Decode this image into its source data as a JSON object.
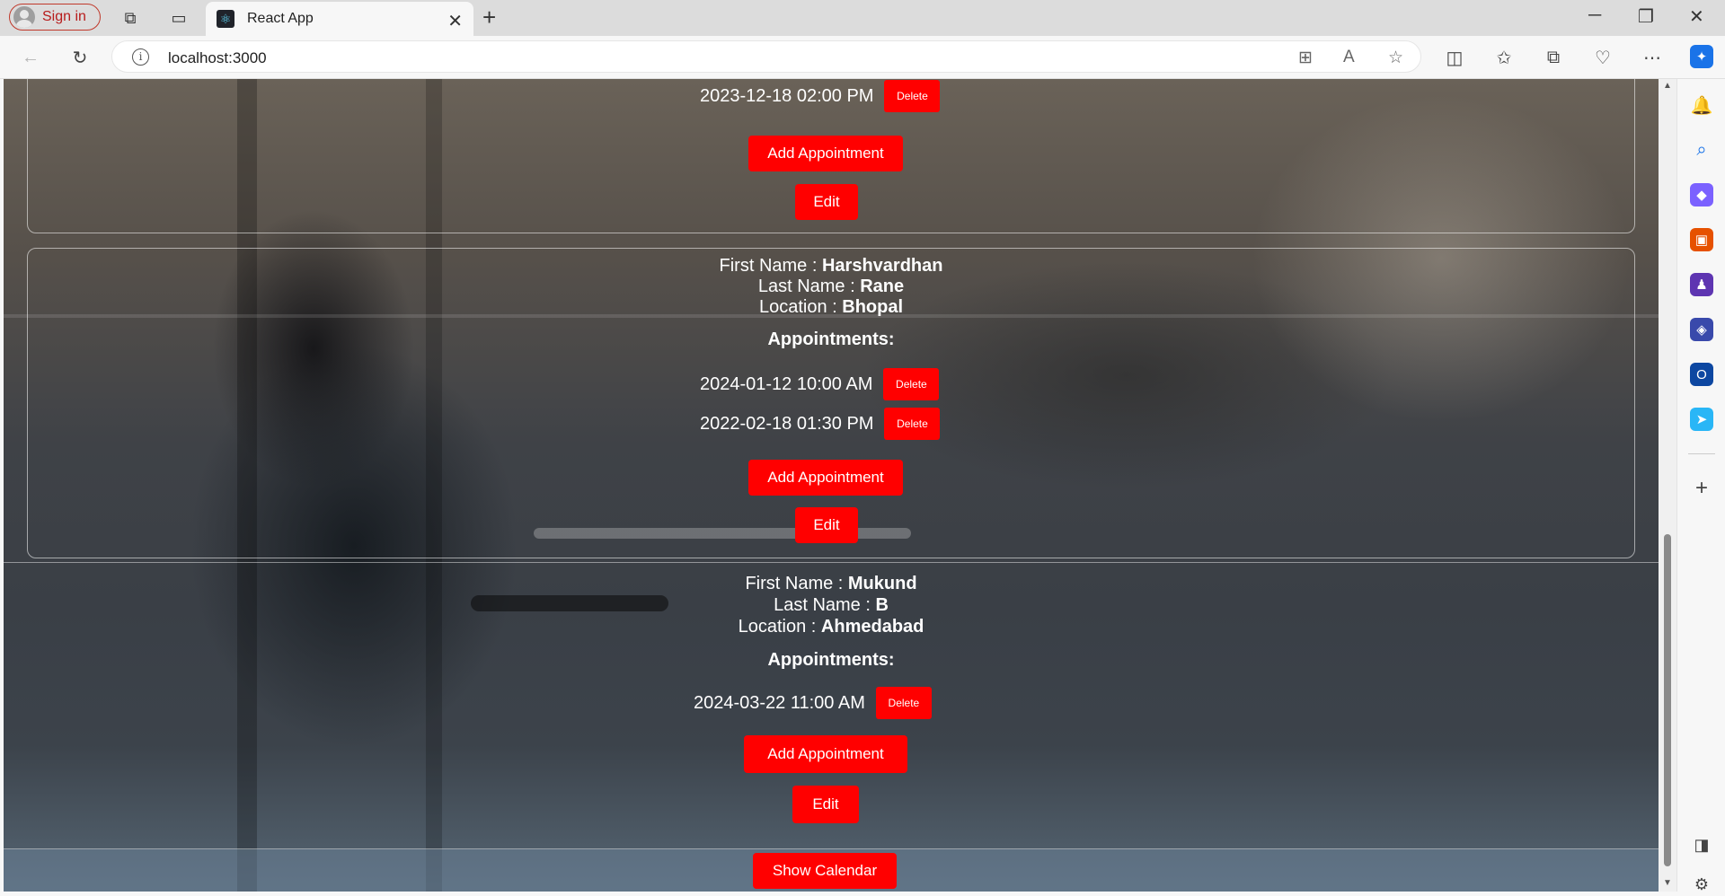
{
  "browser": {
    "signin_label": "Sign in",
    "tab_title": "React App",
    "url": "localhost:3000"
  },
  "top_record": {
    "appointments": [
      {
        "datetime": "2023-12-18 02:00 PM",
        "delete_label": "Delete"
      }
    ],
    "add_label": "Add Appointment",
    "edit_label": "Edit"
  },
  "records": [
    {
      "first_name_label": "First Name : ",
      "first_name": "Harshvardhan",
      "last_name_label": "Last Name : ",
      "last_name": "Rane",
      "location_label": "Location : ",
      "location": "Bhopal",
      "appointments_title": "Appointments:",
      "appointments": [
        {
          "datetime": "2024-01-12 10:00 AM",
          "delete_label": "Delete"
        },
        {
          "datetime": "2022-02-18 01:30 PM",
          "delete_label": "Delete"
        }
      ],
      "add_label": "Add Appointment",
      "edit_label": "Edit"
    },
    {
      "first_name_label": "First Name : ",
      "first_name": "Mukund",
      "last_name_label": "Last Name : ",
      "last_name": "B",
      "location_label": "Location : ",
      "location": "Ahmedabad",
      "appointments_title": "Appointments:",
      "appointments": [
        {
          "datetime": "2024-03-22 11:00 AM",
          "delete_label": "Delete"
        }
      ],
      "add_label": "Add Appointment",
      "edit_label": "Edit"
    }
  ],
  "show_calendar_label": "Show Calendar",
  "colors": {
    "button_red": "#ff0000",
    "signin_red": "#b71c1c"
  }
}
